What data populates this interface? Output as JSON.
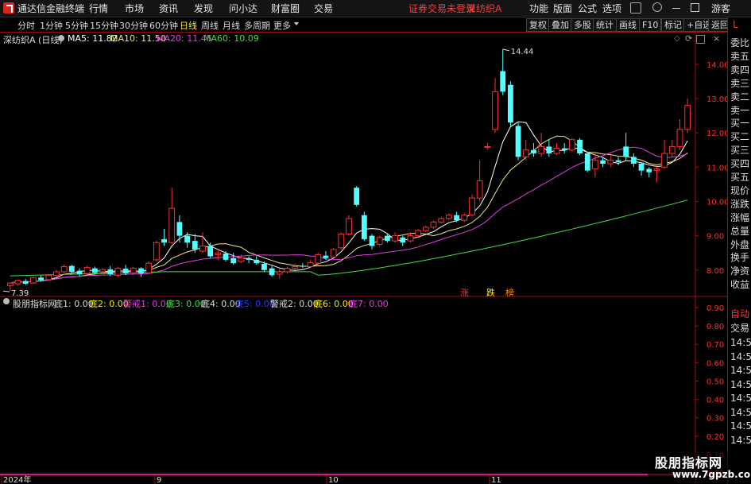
{
  "menubar": {
    "app_title": "通达信金融终端",
    "items": [
      "行情",
      "市场",
      "资讯",
      "发现",
      "问小达",
      "财富圈",
      "交易"
    ],
    "warning": "证券交易未登录",
    "stock": "深纺织A",
    "right_items": [
      "功能",
      "版面",
      "公式",
      "选项"
    ],
    "guest": "游客"
  },
  "periodbar": {
    "items": [
      "分时",
      "1分钟",
      "5分钟",
      "15分钟",
      "30分钟",
      "60分钟",
      "日线",
      "周线",
      "月线",
      "多周期",
      "更多"
    ],
    "active": "日线",
    "tools": [
      "复权",
      "叠加",
      "多股",
      "统计",
      "画线",
      "F10",
      "标记",
      "+自选",
      "返回"
    ]
  },
  "chart_header": {
    "stock_label": "深纺织A (日线)",
    "ma": [
      {
        "label": "MA5: 11.82",
        "color": "#ffffff"
      },
      {
        "label": "MA10: 11.50",
        "color": "#f0e68c"
      },
      {
        "label": "MA20: 11.45",
        "color": "#e040e0"
      },
      {
        "label": "MA60: 10.09",
        "color": "#40e040"
      }
    ]
  },
  "indicator_header": {
    "name": "股朋指标网",
    "items": [
      {
        "label": "底1: 0.00",
        "color": "#dddddd"
      },
      {
        "label": "底2: 0.00",
        "color": "#ffee00"
      },
      {
        "label": "警戒1: 0.00",
        "color": "#e040e0"
      },
      {
        "label": "底3: 0.00",
        "color": "#40e040"
      },
      {
        "label": "底4: 0.00",
        "color": "#dddddd"
      },
      {
        "label": "底5: 0.00",
        "color": "#2040ff"
      },
      {
        "label": "警戒2: 0.00",
        "color": "#dddddd"
      },
      {
        "label": "底6: 0.00",
        "color": "#ffee00"
      },
      {
        "label": "底7: 0.00",
        "color": "#e040e0"
      }
    ]
  },
  "right_panel": {
    "marker": "L",
    "quote_labels": [
      "委比",
      "卖五",
      "卖四",
      "卖三",
      "卖二",
      "卖一",
      "买一",
      "买二",
      "买三",
      "买四",
      "买五",
      "现价",
      "涨跌",
      "涨幅",
      "总量",
      "外盘",
      "换手",
      "净资",
      "收益"
    ],
    "trade_labels": [
      "自动",
      "交易"
    ],
    "times": [
      "14:56",
      "14:56",
      "14:56",
      "14:56",
      "14:56",
      "14:56",
      "14:56",
      "14:56"
    ]
  },
  "signal_tags": [
    {
      "text": "涨",
      "color": "#ff3030"
    },
    {
      "text": "跌",
      "color": "#ffee00"
    },
    {
      "text": "榜",
      "color": "#ff8c00"
    }
  ],
  "watermark": {
    "title": "股朋指标网",
    "url": "www.7gpzb.com"
  },
  "chart_data": {
    "type": "candlestick",
    "y_ticks": [
      14.0,
      13.0,
      12.0,
      11.0,
      10.0,
      9.0,
      8.0
    ],
    "ylim": [
      7.3,
      14.9
    ],
    "max_label": "14.44",
    "min_label": "7.39",
    "x_labels": [
      "2024年",
      "9",
      "10",
      "11"
    ],
    "indicator_y_ticks": [
      0.9,
      0.8,
      0.7,
      0.6,
      0.5,
      0.4,
      0.3,
      0.2,
      0.1,
      0.0
    ],
    "candles": [
      [
        7.55,
        7.62,
        7.58,
        7.39
      ],
      [
        7.6,
        7.7,
        7.72,
        7.55
      ],
      [
        7.68,
        7.6,
        7.74,
        7.56
      ],
      [
        7.62,
        7.78,
        7.8,
        7.6
      ],
      [
        7.78,
        7.7,
        7.84,
        7.66
      ],
      [
        7.72,
        7.85,
        7.88,
        7.7
      ],
      [
        7.84,
        7.95,
        8.0,
        7.8
      ],
      [
        7.95,
        8.1,
        8.16,
        7.92
      ],
      [
        8.12,
        7.95,
        8.15,
        7.9
      ],
      [
        7.98,
        7.88,
        8.05,
        7.82
      ],
      [
        7.9,
        8.08,
        8.12,
        7.86
      ],
      [
        8.05,
        7.92,
        8.1,
        7.88
      ],
      [
        7.95,
        8.0,
        8.06,
        7.9
      ],
      [
        8.02,
        7.88,
        8.12,
        7.82
      ],
      [
        7.85,
        8.05,
        8.1,
        7.8
      ],
      [
        8.04,
        7.9,
        8.15,
        7.86
      ],
      [
        7.92,
        8.05,
        8.1,
        7.85
      ],
      [
        8.05,
        7.9,
        8.08,
        7.8
      ],
      [
        7.92,
        8.2,
        8.25,
        7.9
      ],
      [
        8.3,
        8.8,
        8.85,
        8.25
      ],
      [
        8.9,
        8.8,
        9.2,
        8.7
      ],
      [
        8.8,
        9.8,
        10.4,
        8.75
      ],
      [
        9.4,
        9.0,
        9.6,
        8.8
      ],
      [
        9.0,
        8.8,
        9.1,
        8.65
      ],
      [
        8.85,
        8.6,
        9.05,
        8.5
      ],
      [
        8.55,
        8.7,
        9.1,
        8.5
      ],
      [
        8.7,
        8.4,
        8.8,
        8.35
      ],
      [
        8.45,
        8.5,
        8.6,
        8.3
      ],
      [
        8.48,
        8.3,
        8.55,
        8.25
      ],
      [
        8.35,
        8.2,
        8.5,
        8.15
      ],
      [
        8.25,
        8.35,
        8.45,
        8.2
      ],
      [
        8.35,
        8.3,
        8.4,
        8.2
      ],
      [
        8.3,
        8.2,
        8.42,
        8.15
      ],
      [
        8.18,
        8.0,
        8.25,
        7.95
      ],
      [
        8.05,
        7.85,
        8.12,
        7.8
      ],
      [
        7.88,
        7.95,
        8.05,
        7.75
      ],
      [
        7.95,
        8.05,
        8.1,
        7.9
      ],
      [
        8.05,
        8.1,
        8.18,
        8.0
      ],
      [
        8.12,
        8.1,
        8.2,
        8.05
      ],
      [
        8.1,
        8.22,
        8.3,
        8.05
      ],
      [
        8.2,
        8.45,
        8.5,
        8.15
      ],
      [
        8.42,
        8.35,
        8.55,
        8.3
      ],
      [
        8.38,
        8.6,
        8.65,
        8.35
      ],
      [
        8.65,
        9.05,
        9.1,
        8.6
      ],
      [
        9.05,
        9.5,
        9.6,
        9.0
      ],
      [
        10.4,
        9.9,
        10.45,
        9.85
      ],
      [
        9.6,
        8.9,
        9.7,
        8.85
      ],
      [
        9.0,
        8.7,
        9.05,
        8.6
      ],
      [
        8.75,
        8.95,
        9.0,
        8.7
      ],
      [
        9.0,
        8.85,
        9.05,
        8.8
      ],
      [
        8.85,
        9.0,
        9.1,
        8.8
      ],
      [
        8.95,
        8.8,
        9.0,
        8.7
      ],
      [
        8.85,
        9.0,
        9.1,
        8.8
      ],
      [
        9.0,
        9.15,
        9.2,
        8.95
      ],
      [
        9.15,
        9.25,
        9.3,
        9.1
      ],
      [
        9.25,
        9.4,
        9.45,
        9.2
      ],
      [
        9.4,
        9.5,
        9.55,
        9.35
      ],
      [
        9.5,
        9.6,
        9.65,
        9.45
      ],
      [
        9.6,
        9.45,
        9.7,
        9.4
      ],
      [
        9.45,
        9.6,
        9.65,
        9.4
      ],
      [
        9.6,
        10.1,
        10.2,
        9.55
      ],
      [
        10.1,
        10.6,
        11.2,
        10.0
      ],
      [
        11.6,
        11.6,
        11.7,
        11.5
      ],
      [
        12.1,
        13.2,
        13.6,
        12.0
      ],
      [
        13.8,
        13.2,
        14.44,
        13.1
      ],
      [
        13.4,
        12.3,
        13.5,
        12.2
      ],
      [
        12.2,
        11.3,
        12.3,
        11.2
      ],
      [
        11.3,
        11.5,
        11.8,
        11.2
      ],
      [
        11.5,
        11.4,
        11.7,
        11.3
      ],
      [
        11.4,
        11.6,
        12.0,
        11.3
      ],
      [
        11.6,
        11.4,
        11.8,
        11.3
      ],
      [
        11.4,
        11.55,
        11.7,
        11.35
      ],
      [
        11.55,
        11.5,
        11.7,
        11.4
      ],
      [
        11.5,
        11.8,
        11.85,
        11.45
      ],
      [
        11.8,
        11.4,
        11.85,
        11.35
      ],
      [
        11.4,
        10.9,
        11.45,
        10.85
      ],
      [
        10.95,
        11.2,
        11.4,
        10.7
      ],
      [
        11.2,
        11.1,
        11.3,
        11.0
      ],
      [
        11.1,
        11.2,
        11.35,
        11.0
      ],
      [
        11.2,
        11.15,
        11.3,
        11.05
      ],
      [
        11.6,
        11.3,
        12.0,
        11.2
      ],
      [
        11.3,
        11.1,
        11.4,
        11.0
      ],
      [
        11.1,
        10.9,
        11.15,
        10.75
      ],
      [
        10.95,
        10.85,
        11.0,
        10.7
      ],
      [
        10.9,
        10.95,
        11.05,
        10.55
      ],
      [
        11.0,
        11.4,
        11.8,
        10.95
      ],
      [
        11.4,
        11.6,
        11.8,
        11.3
      ],
      [
        11.6,
        12.1,
        12.4,
        11.5
      ],
      [
        12.1,
        12.8,
        13.0,
        12.0
      ]
    ]
  }
}
